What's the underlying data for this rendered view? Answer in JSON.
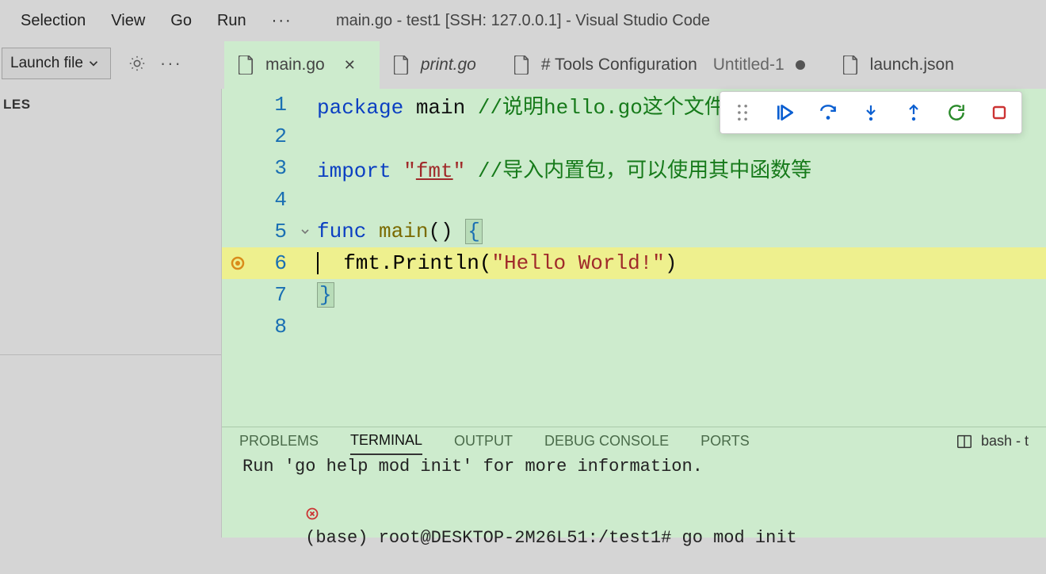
{
  "menu": {
    "items": [
      "Selection",
      "View",
      "Go",
      "Run"
    ],
    "more": "···"
  },
  "window_title": "main.go - test1 [SSH: 127.0.0.1] - Visual Studio Code",
  "launch_config": "Launch file",
  "sidebar_heading": "LES",
  "tabs": [
    {
      "label": "main.go",
      "icon": "file-icon",
      "active": true,
      "close": true,
      "dirty": false,
      "italic": false
    },
    {
      "label": "print.go",
      "icon": "file-icon",
      "active": false,
      "close": false,
      "dirty": false,
      "italic": true
    },
    {
      "label": "# Tools Configuration",
      "suffix": "Untitled-1",
      "icon": "file-icon",
      "active": false,
      "close": false,
      "dirty": true,
      "italic": false
    },
    {
      "label": "launch.json",
      "icon": "file-icon",
      "active": false,
      "close": false,
      "dirty": false,
      "italic": false
    }
  ],
  "code": {
    "lines": [
      {
        "n": 1,
        "tokens": [
          [
            "kw",
            "package "
          ],
          [
            "ident",
            "main "
          ],
          [
            "comment",
            "//说明hello.go这个文件"
          ]
        ]
      },
      {
        "n": 2,
        "tokens": []
      },
      {
        "n": 3,
        "tokens": [
          [
            "kw",
            "import "
          ],
          [
            "str",
            "\""
          ],
          [
            "str-under",
            "fmt"
          ],
          [
            "str",
            "\" "
          ],
          [
            "comment",
            "//导入内置包，可以使用其中函数等"
          ]
        ]
      },
      {
        "n": 4,
        "tokens": []
      },
      {
        "n": 5,
        "fold": true,
        "tokens": [
          [
            "kw",
            "func "
          ],
          [
            "fn",
            "main"
          ],
          [
            "paren",
            "() "
          ],
          [
            "brace-box",
            "{"
          ]
        ]
      },
      {
        "n": 6,
        "bp": true,
        "hl": true,
        "cursor": true,
        "tokens": [
          [
            "plain",
            "  fmt.Println("
          ],
          [
            "str",
            "\"Hello World!\""
          ],
          [
            "paren",
            ")"
          ]
        ]
      },
      {
        "n": 7,
        "tokens": [
          [
            "brace-box",
            "}"
          ]
        ]
      },
      {
        "n": 8,
        "tokens": []
      }
    ]
  },
  "debug_toolbar": {
    "buttons": [
      "grip",
      "continue",
      "step-over",
      "step-into",
      "step-out",
      "restart",
      "stop"
    ]
  },
  "panel": {
    "tabs": [
      "PROBLEMS",
      "TERMINAL",
      "OUTPUT",
      "DEBUG CONSOLE",
      "PORTS"
    ],
    "active": "TERMINAL",
    "right_label": "bash - t"
  },
  "terminal": {
    "lines": [
      "Run 'go help mod init' for more information.",
      "(base) root@DESKTOP-2M26L51:/test1# go mod init"
    ]
  }
}
